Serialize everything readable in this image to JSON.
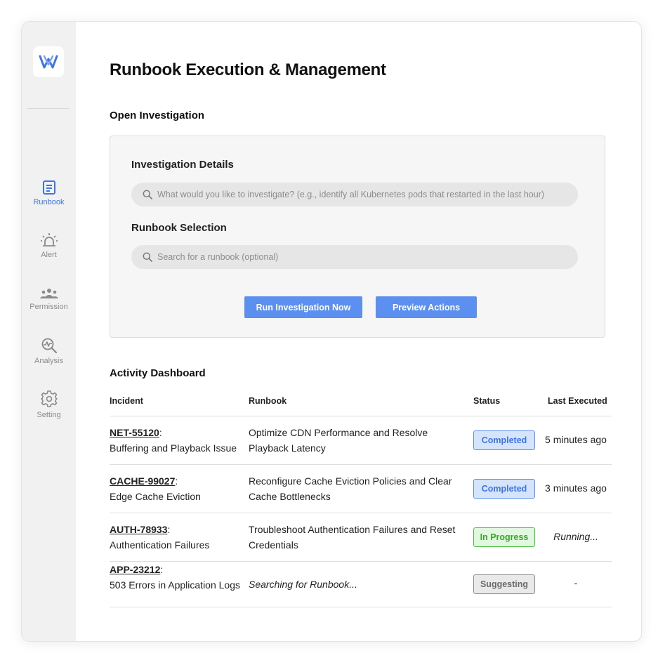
{
  "sidebar": {
    "logo_icon": "w-logo-icon",
    "items": [
      {
        "label": "Runbook",
        "icon": "document-icon",
        "active": true
      },
      {
        "label": "Alert",
        "icon": "alarm-icon",
        "active": false
      },
      {
        "label": "Permission",
        "icon": "users-icon",
        "active": false
      },
      {
        "label": "Analysis",
        "icon": "analysis-icon",
        "active": false
      },
      {
        "label": "Setting",
        "icon": "gear-icon",
        "active": false
      }
    ]
  },
  "page": {
    "title": "Runbook Execution & Management"
  },
  "open_investigation": {
    "title": "Open Investigation",
    "details_label": "Investigation Details",
    "details_placeholder": "What would you like to investigate? (e.g., identify all Kubernetes pods that restarted in the last hour)",
    "details_value": "",
    "runbook_label": "Runbook Selection",
    "runbook_placeholder": "Search for a runbook (optional)",
    "runbook_value": "",
    "run_button": "Run Investigation Now",
    "preview_button": "Preview Actions"
  },
  "dashboard": {
    "title": "Activity Dashboard",
    "columns": {
      "incident": "Incident",
      "runbook": "Runbook",
      "status": "Status",
      "last_executed": "Last Executed"
    },
    "rows": [
      {
        "id": "NET-55120",
        "desc": "Buffering and Playback Issue",
        "runbook": "Optimize CDN Performance and Resolve Playback Latency",
        "status": "Completed",
        "last": "5 minutes ago"
      },
      {
        "id": "CACHE-99027",
        "desc": "Edge Cache Eviction",
        "runbook": "Reconfigure Cache Eviction Policies and Clear Cache Bottlenecks",
        "status": "Completed",
        "last": "3 minutes ago"
      },
      {
        "id": "AUTH-78933",
        "desc": "Authentication Failures",
        "runbook": "Troubleshoot Authentication Failures and Reset Credentials",
        "status": "In Progress",
        "last": "Running..."
      },
      {
        "id": "APP-23212",
        "desc": "503 Errors in Application Logs",
        "runbook": "Searching for Runbook...",
        "status": "Suggesting",
        "last": "-"
      }
    ]
  },
  "colors": {
    "accent": "#5b8ff0",
    "active_nav": "#3d74e8",
    "in_progress": "#4cc041",
    "suggesting": "#8e8e8e"
  }
}
